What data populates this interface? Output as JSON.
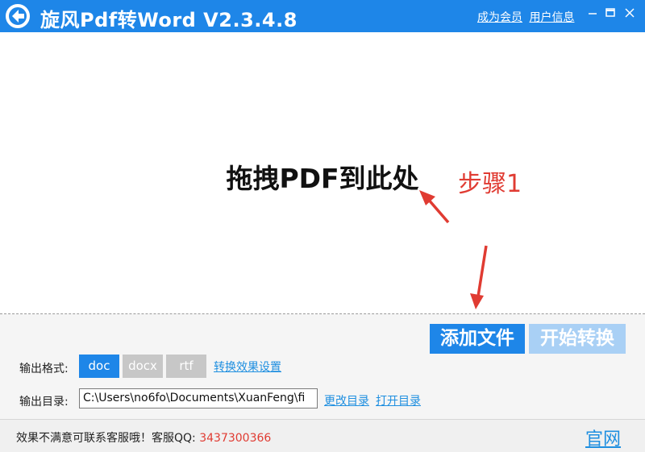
{
  "app": {
    "title": "旋风Pdf转Word  V2.3.4.8"
  },
  "titlebar": {
    "member_link": "成为会员",
    "user_link": "用户信息"
  },
  "dropzone": {
    "prompt": "拖拽PDF到此处"
  },
  "annotation": {
    "step": "步骤1"
  },
  "actions": {
    "add_files": "添加文件",
    "start_convert": "开始转换"
  },
  "format": {
    "label": "输出格式:",
    "options": [
      {
        "label": "doc",
        "selected": true
      },
      {
        "label": "docx",
        "selected": false
      },
      {
        "label": "rtf",
        "selected": false
      }
    ],
    "settings_link": "转换效果设置"
  },
  "output": {
    "label": "输出目录:",
    "path": "C:\\Users\\no6fo\\Documents\\XuanFeng\\fi",
    "change_link": "更改目录",
    "open_link": "打开目录"
  },
  "footer": {
    "support_text": "效果不满意可联系客服哦！客服QQ: ",
    "qq_number": "3437300366",
    "official_link": "官网"
  },
  "colors": {
    "accent": "#1e86e8",
    "annotation": "#e03b32",
    "link": "#1f8fe0"
  }
}
